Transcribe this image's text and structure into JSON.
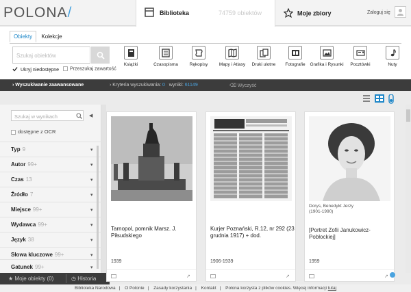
{
  "header": {
    "logo": "POLONA",
    "logo_slash": "/",
    "tab_library": "Biblioteka",
    "tab_library_count": "74759 obiektów",
    "tab_favorites": "Moje zbiory",
    "login": "Zaloguj się"
  },
  "panel": {
    "tabs": [
      {
        "label": "Obiekty"
      },
      {
        "label": "Kolekcje"
      }
    ],
    "search_placeholder": "Szukaj obiektów",
    "check_hide": "Ukryj niedostępne",
    "check_content": "Przeszukaj zawartość",
    "categories": [
      {
        "label": "Książki",
        "icon": "book-icon"
      },
      {
        "label": "Czasopisma",
        "icon": "newspaper-icon"
      },
      {
        "label": "Rękopisy",
        "icon": "manuscript-icon"
      },
      {
        "label": "Mapy i Atlasy",
        "icon": "map-icon"
      },
      {
        "label": "Druki ulotne",
        "icon": "leaflet-icon"
      },
      {
        "label": "Fotografie",
        "icon": "photo-icon"
      },
      {
        "label": "Grafika i Rysunki",
        "icon": "graphic-icon"
      },
      {
        "label": "Pocztówki",
        "icon": "postcard-icon"
      },
      {
        "label": "Nuty",
        "icon": "music-icon"
      }
    ]
  },
  "bar": {
    "advanced": "Wyszukiwanie zaawansowane",
    "criteria_label": "Kryteria wyszukiwania:",
    "criteria_count": "0",
    "results_label": "wyniki:",
    "results_count": "61149",
    "clear": "Wyczyść"
  },
  "sidebar": {
    "filter_placeholder": "Szukaj w wynikach",
    "ocr": "dostępne z OCR",
    "filters": [
      {
        "label": "Typ",
        "count": "9"
      },
      {
        "label": "Autor",
        "count": "99+"
      },
      {
        "label": "Czas",
        "count": "13"
      },
      {
        "label": "Źródło",
        "count": "7"
      },
      {
        "label": "Miejsce",
        "count": "99+"
      },
      {
        "label": "Wydawca",
        "count": "99+"
      },
      {
        "label": "Język",
        "count": "38"
      },
      {
        "label": "Słowa kluczowe",
        "count": "99+"
      },
      {
        "label": "Gatunek",
        "count": "99+"
      }
    ],
    "bottom_my": "Moje obiekty (0)",
    "bottom_history": "Historia"
  },
  "results": [
    {
      "meta": "",
      "title": "Tarnopol, pomnik Marsz. J. Piłsudskiego",
      "year": "1939"
    },
    {
      "meta": "",
      "title": "Kurjer Poznański, R.12, nr 292 (23 grudnia 1917) + dod.",
      "year": "1906-1939"
    },
    {
      "meta_line1": "Dorys, Benedykt Jerzy",
      "meta_line2": "(1901-1990)",
      "title": "[Portret Zofii Janukowicz-Pobłockiej]",
      "year": "1959"
    }
  ],
  "footer": {
    "links": [
      "Biblioteka Narodowa",
      "O Polonie",
      "Zasady korzystania",
      "Kontakt"
    ],
    "cookies": "Polona korzysta z plików cookies. Więcej informacji",
    "cookies_link": "tutaj"
  },
  "colors": {
    "accent": "#1c86c8",
    "dark_bar": "#3c3c3c"
  }
}
